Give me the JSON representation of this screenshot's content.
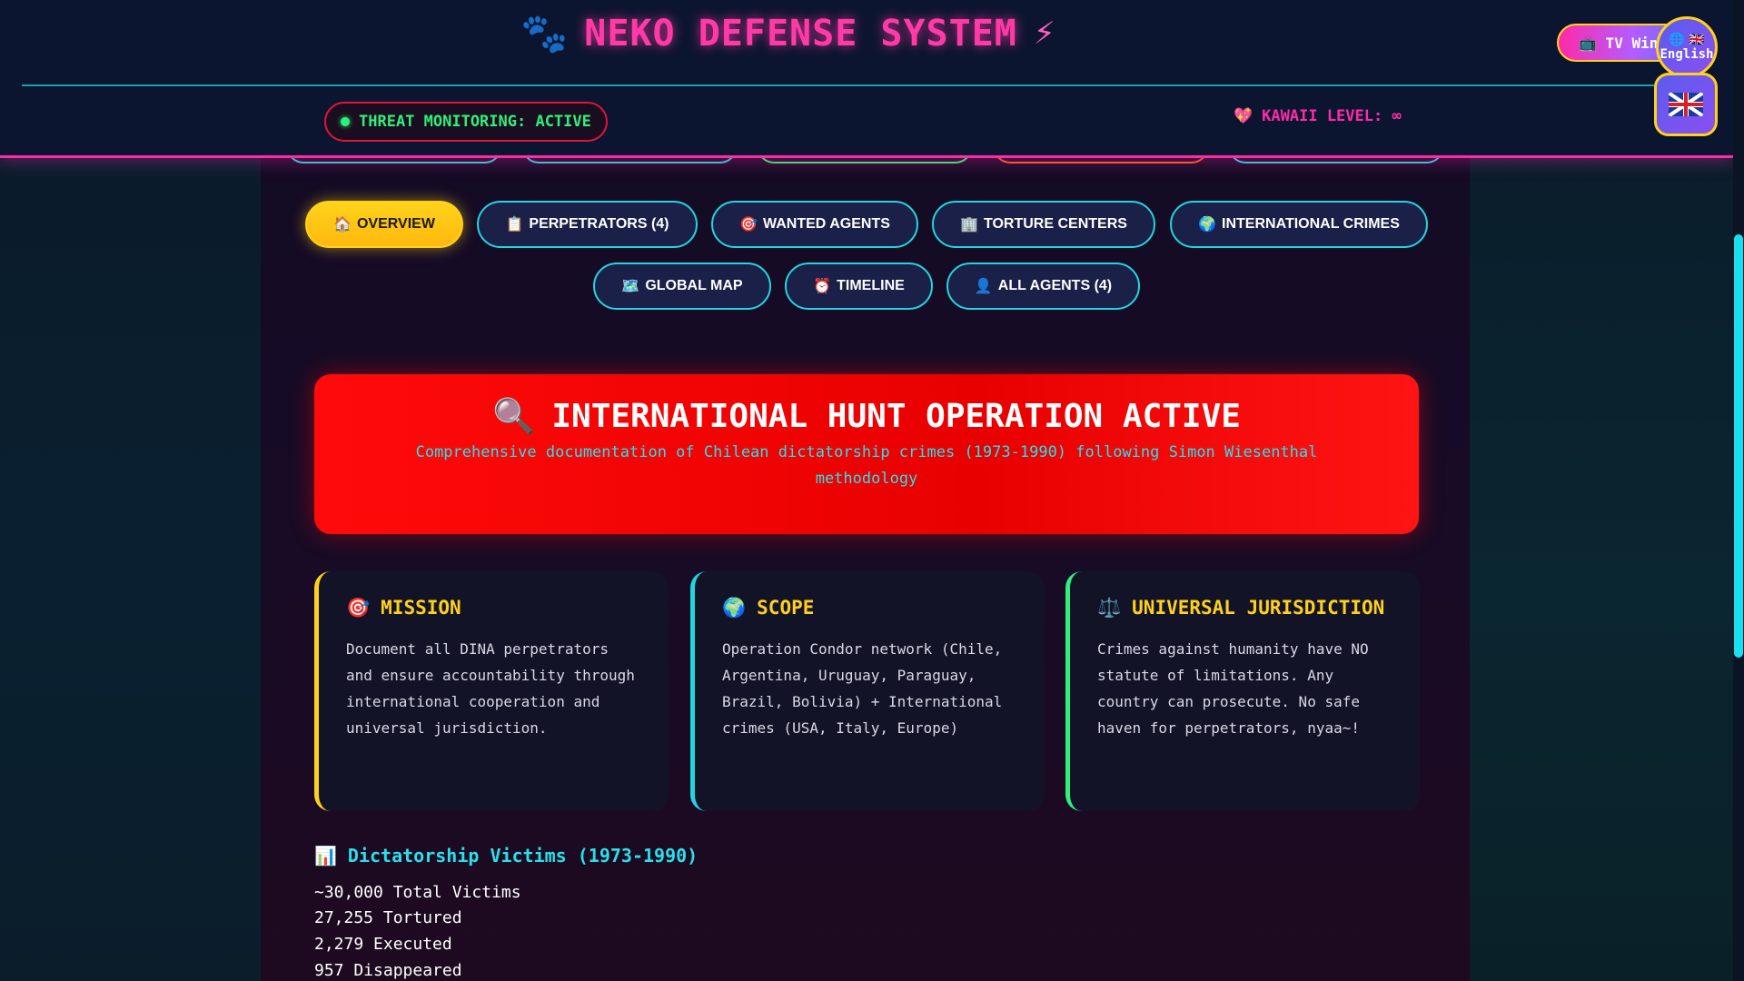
{
  "header": {
    "paw_icon": "🐾",
    "title": "NEKO DEFENSE SYSTEM",
    "bolt_icon": "⚡",
    "tv_button": "📺 TV Win",
    "lang_bubble_flags": "🌐 🇬🇧",
    "lang_bubble_label": "English",
    "threat_status": "THREAT MONITORING: ACTIVE",
    "kawaii_icon": "💖",
    "kawaii_level": "KAWAII LEVEL: ∞"
  },
  "nav": {
    "tabs": [
      {
        "icon": "🏠",
        "label": "OVERVIEW",
        "active": true
      },
      {
        "icon": "📋",
        "label": "PERPETRATORS (4)"
      },
      {
        "icon": "🎯",
        "label": "WANTED AGENTS"
      },
      {
        "icon": "🏢",
        "label": "TORTURE CENTERS"
      },
      {
        "icon": "🌍",
        "label": "INTERNATIONAL CRIMES"
      },
      {
        "icon": "🗺️",
        "label": "GLOBAL MAP"
      },
      {
        "icon": "⏰",
        "label": "TIMELINE"
      },
      {
        "icon": "👤",
        "label": "ALL AGENTS (4)"
      }
    ]
  },
  "hero": {
    "icon": "🔍",
    "title": "INTERNATIONAL HUNT OPERATION ACTIVE",
    "subtitle": "Comprehensive documentation of Chilean dictatorship crimes (1973-1990) following Simon Wiesenthal methodology"
  },
  "cards": [
    {
      "icon": "🎯",
      "title": "MISSION",
      "text": "Document all DINA perpetrators and ensure accountability through international cooperation and universal jurisdiction."
    },
    {
      "icon": "🌍",
      "title": "SCOPE",
      "text": "Operation Condor network (Chile, Argentina, Uruguay, Paraguay, Brazil, Bolivia) + International crimes (USA, Italy, Europe)"
    },
    {
      "icon": "⚖️",
      "title": "UNIVERSAL JURISDICTION",
      "text": "Crimes against humanity have NO statute of limitations. Any country can prosecute. No safe haven for perpetrators, nyaa~!"
    }
  ],
  "stats": {
    "icon": "📊",
    "title": "Dictatorship Victims (1973-1990)",
    "lines": [
      "~30,000 Total Victims",
      "27,255 Tortured",
      "2,279 Executed",
      "957 Disappeared"
    ]
  },
  "colors": {
    "accent_pink": "#ff2aa8",
    "accent_cyan": "#21d6df",
    "accent_yellow": "#ffd21a",
    "hero_red": "#ff0a0a",
    "status_green": "#2ef07a"
  }
}
